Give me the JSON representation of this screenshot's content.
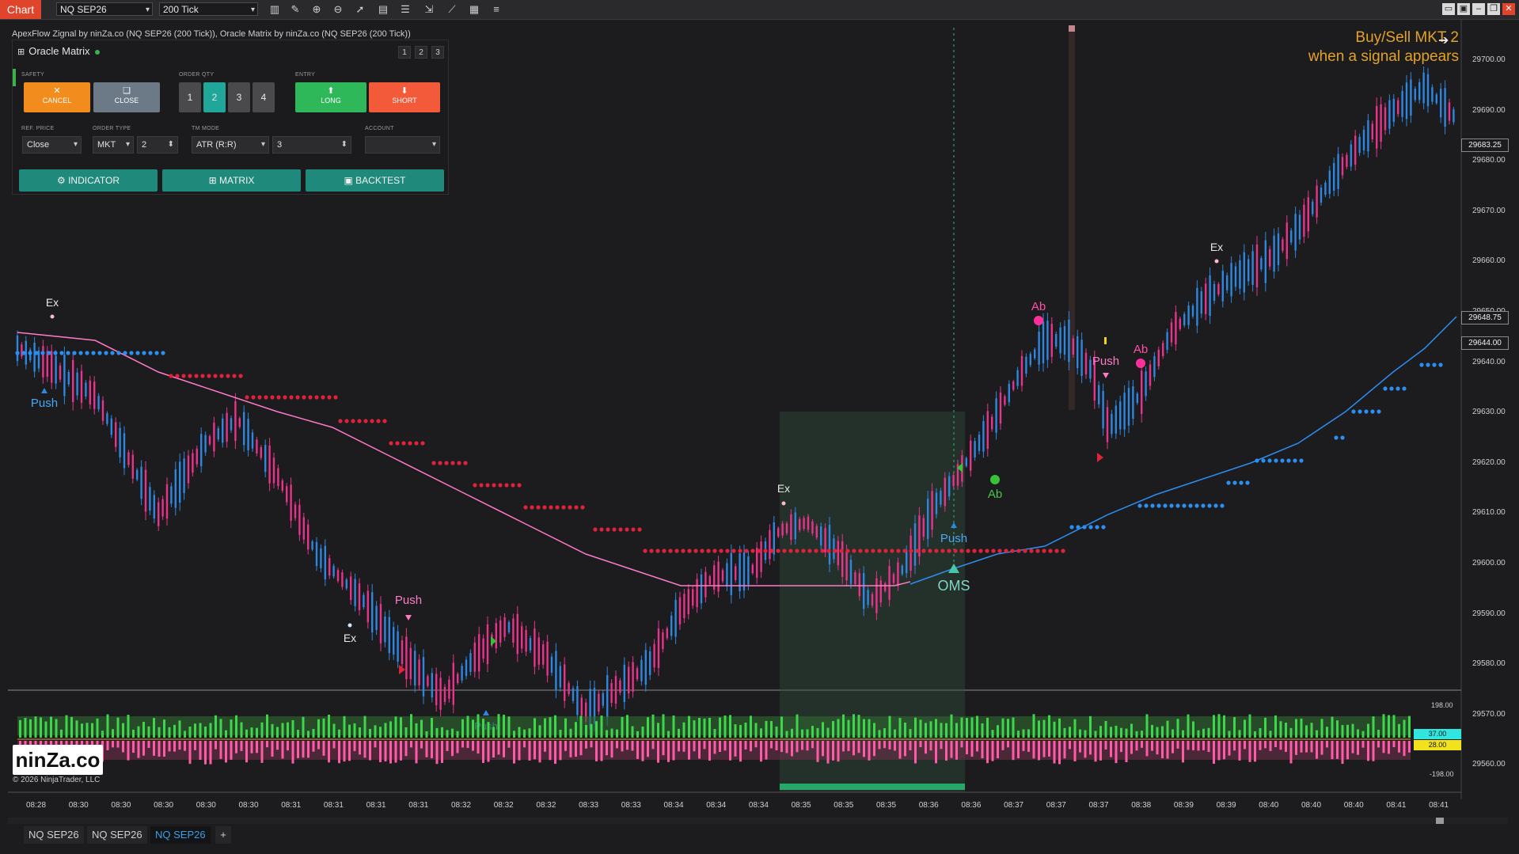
{
  "toolbar": {
    "chart_label": "Chart",
    "instrument": "NQ SEP26",
    "interval": "200 Tick",
    "icons": [
      "bar-chart-icon",
      "pencil-icon",
      "zoom-in-icon",
      "zoom-out-icon",
      "pointer-icon",
      "data-box-icon",
      "properties-icon",
      "scale-icon",
      "strategy-icon",
      "order-icon",
      "list-icon"
    ]
  },
  "chart": {
    "info_line": "ApexFlow Zignal by ninZa.co (NQ SEP26 (200 Tick)), Oracle Matrix by ninZa.co (NQ SEP26 (200 Tick))",
    "annotation_line1": "Buy/Sell MKT 2",
    "annotation_line2": "when a signal appears",
    "price_labels": [
      "29700.00",
      "29690.00",
      "29680.00",
      "29670.00",
      "29660.00",
      "29650.00",
      "29640.00",
      "29630.00",
      "29620.00",
      "29610.00",
      "29600.00",
      "29590.00",
      "29580.00",
      "29570.00",
      "29560.00"
    ],
    "price_tags": [
      "29683.25",
      "29648.75",
      "29644.00"
    ],
    "time_labels": [
      "08:28",
      "08:30",
      "08:30",
      "08:30",
      "08:30",
      "08:30",
      "08:31",
      "08:31",
      "08:31",
      "08:31",
      "08:32",
      "08:32",
      "08:32",
      "08:33",
      "08:33",
      "08:34",
      "08:34",
      "08:34",
      "08:35",
      "08:35",
      "08:35",
      "08:36",
      "08:36",
      "08:37",
      "08:37",
      "08:37",
      "08:38",
      "08:39",
      "08:39",
      "08:40",
      "08:40",
      "08:40",
      "08:41",
      "08:41"
    ],
    "signals": {
      "ex": "Ex",
      "push": "Push",
      "ab": "Ab",
      "oms": "OMS"
    },
    "oscillator": {
      "upper": "198.00",
      "lower": "-198.00",
      "tag1": "37.00",
      "tag2": "28.00"
    },
    "logo": "ninZa.co",
    "copyright": "© 2026 NinjaTrader, LLC",
    "colors": {
      "bull": "#2e86de",
      "bear": "#e8338a",
      "red_dot": "#e0223a",
      "blue_dot": "#2b8ef0",
      "accent": "#e2a22a",
      "teal": "#21a69a"
    }
  },
  "oracle": {
    "title": "Oracle Matrix",
    "pages": [
      "1",
      "2",
      "3"
    ],
    "safety_label": "SAFETY",
    "order_qty_label": "ORDER QTY",
    "entry_label": "ENTRY",
    "cancel": "CANCEL",
    "close": "CLOSE",
    "qty": [
      "1",
      "2",
      "3",
      "4"
    ],
    "long": "LONG",
    "short": "SHORT",
    "ref_price_label": "REF. PRICE",
    "ref_price": "Close",
    "order_type_label": "ORDER TYPE",
    "order_type": "MKT",
    "order_type_qty": "2",
    "tm_mode_label": "TM MODE",
    "tm_mode": "ATR (R:R)",
    "tm_value": "3",
    "account_label": "ACCOUNT",
    "account": "",
    "indicator": "INDICATOR",
    "matrix": "MATRIX",
    "backtest": "BACKTEST"
  },
  "tabs": [
    "NQ SEP26",
    "NQ SEP26",
    "NQ SEP26"
  ],
  "add_tab": "+"
}
